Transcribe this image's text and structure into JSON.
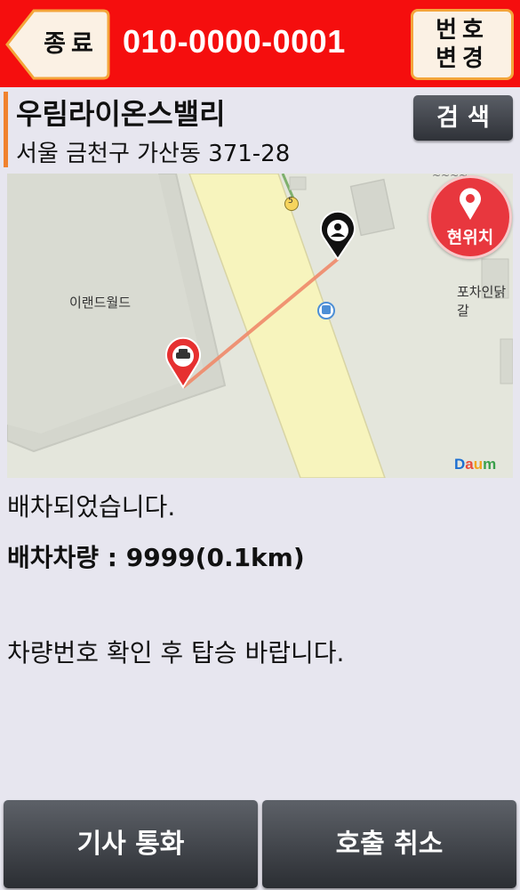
{
  "header": {
    "back_label": "종료",
    "phone_number": "010-0000-0001",
    "change_label_line1": "번호",
    "change_label_line2": "변경"
  },
  "location": {
    "place_name": "우림라이온스밸리",
    "address": "서울 금천구 가산동 371-28",
    "search_label": "검색"
  },
  "map": {
    "poi_left": "이랜드월드",
    "poi_right": "포차인닭갈",
    "road_number": "5",
    "provider": "Daum",
    "current_location_label": "현위치",
    "taxi_icon": "taxi-marker-icon",
    "user_icon": "user-marker-icon",
    "route_color": "#f08a6a"
  },
  "status": {
    "dispatched": "배차되었습니다.",
    "vehicle": "배차차량 : 9999(0.1km)",
    "instruction": "차량번호 확인 후 탑승 바랍니다."
  },
  "actions": {
    "call_driver": "기사 통화",
    "cancel_call": "호출 취소"
  },
  "colors": {
    "header": "#f50e0e",
    "accent": "#f4a53a",
    "button_dark": "#2f3238"
  }
}
